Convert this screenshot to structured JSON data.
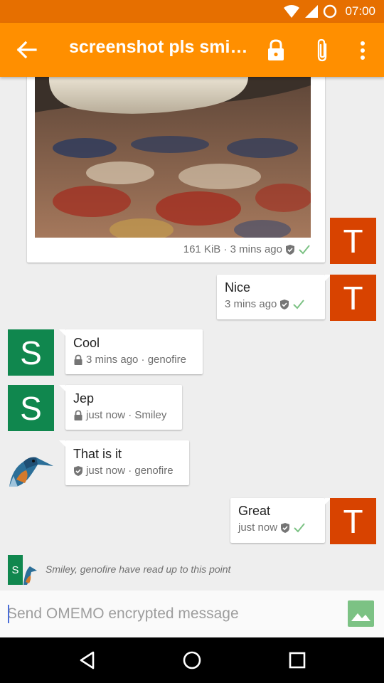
{
  "status_bar": {
    "time": "07:00"
  },
  "toolbar": {
    "title": "screenshot pls smiley",
    "back_icon": "arrow-left-icon",
    "lock_icon": "lock-icon",
    "attach_icon": "paperclip-icon",
    "menu_icon": "more-vert-icon"
  },
  "messages": [
    {
      "direction": "out",
      "type": "image",
      "meta": "161 KiB · 3 mins ago",
      "avatar": "T"
    },
    {
      "direction": "out",
      "text": "Nice",
      "meta": "3 mins ago",
      "avatar": "T"
    },
    {
      "direction": "in",
      "text": "Cool",
      "meta": "3 mins ago · genofire",
      "avatar": "S",
      "security": "lock"
    },
    {
      "direction": "in",
      "text": "Jep",
      "meta": "just now · Smiley",
      "avatar": "S",
      "security": "lock"
    },
    {
      "direction": "in",
      "text": "That is it",
      "meta": "just now · genofire",
      "avatar": "bird",
      "security": "shield"
    },
    {
      "direction": "out",
      "text": "Great",
      "meta": "just now",
      "avatar": "T"
    }
  ],
  "read_marker": {
    "avatar_letter": "S",
    "text": "Smiley, genofire have read up to this point"
  },
  "composer": {
    "placeholder": "Send OMEMO encrypted message",
    "media_icon": "image-icon"
  },
  "colors": {
    "status_bar": "#e66f00",
    "toolbar": "#ff8f00",
    "avatar_self": "#d84300",
    "avatar_contact": "#10874e",
    "check": "#7cc284"
  }
}
